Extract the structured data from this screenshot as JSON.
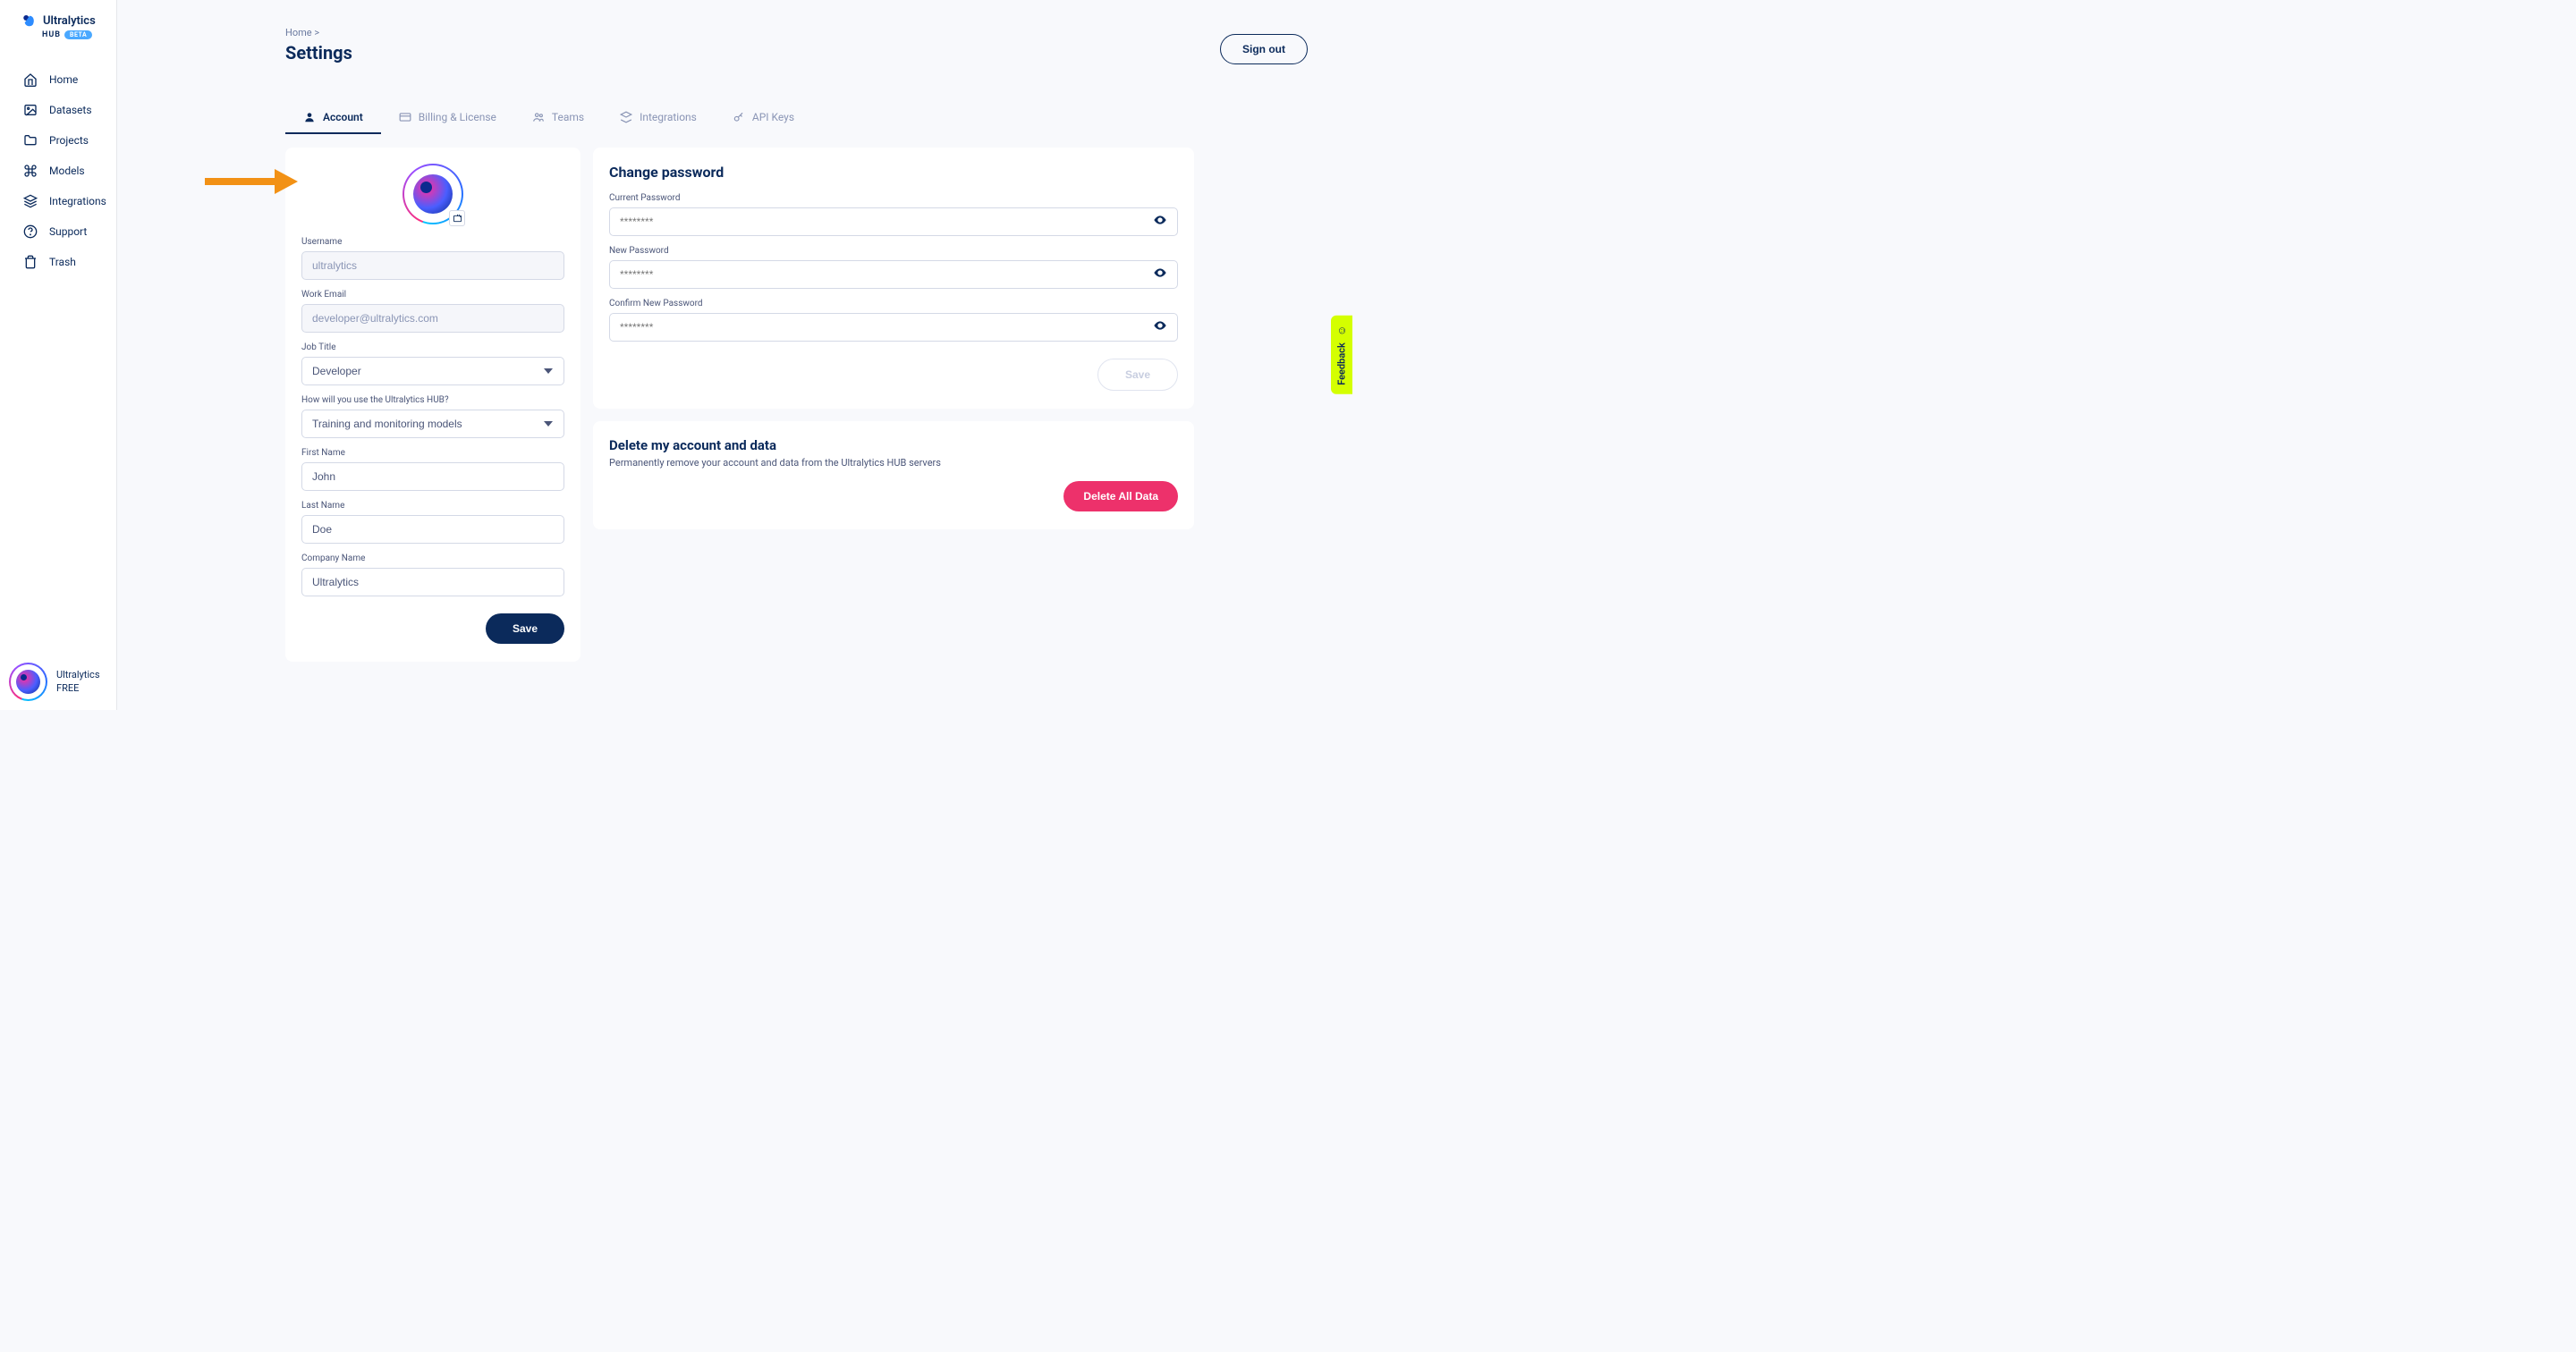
{
  "brand": {
    "name": "Ultralytics",
    "sub": "HUB",
    "badge": "BETA"
  },
  "sidebar": {
    "items": [
      {
        "label": "Home"
      },
      {
        "label": "Datasets"
      },
      {
        "label": "Projects"
      },
      {
        "label": "Models"
      },
      {
        "label": "Integrations"
      },
      {
        "label": "Support"
      },
      {
        "label": "Trash"
      }
    ]
  },
  "user_footer": {
    "name": "Ultralytics",
    "plan": "FREE"
  },
  "breadcrumb": {
    "home": "Home",
    "sep": ">"
  },
  "page": {
    "title": "Settings"
  },
  "signout": "Sign out",
  "tabs": [
    {
      "label": "Account"
    },
    {
      "label": "Billing & License"
    },
    {
      "label": "Teams"
    },
    {
      "label": "Integrations"
    },
    {
      "label": "API Keys"
    }
  ],
  "profile": {
    "username_label": "Username",
    "username_value": "ultralytics",
    "email_label": "Work Email",
    "email_value": "developer@ultralytics.com",
    "job_label": "Job Title",
    "job_value": "Developer",
    "usage_label": "How will you use the Ultralytics HUB?",
    "usage_value": "Training and monitoring models",
    "first_label": "First Name",
    "first_value": "John",
    "last_label": "Last Name",
    "last_value": "Doe",
    "company_label": "Company Name",
    "company_value": "Ultralytics",
    "save": "Save"
  },
  "password": {
    "title": "Change password",
    "current_label": "Current Password",
    "new_label": "New Password",
    "confirm_label": "Confirm New Password",
    "placeholder": "********",
    "save": "Save"
  },
  "delete": {
    "title": "Delete my account and data",
    "sub": "Permanently remove your account and data from the Ultralytics HUB servers",
    "button": "Delete All Data"
  },
  "feedback": "Feedback"
}
